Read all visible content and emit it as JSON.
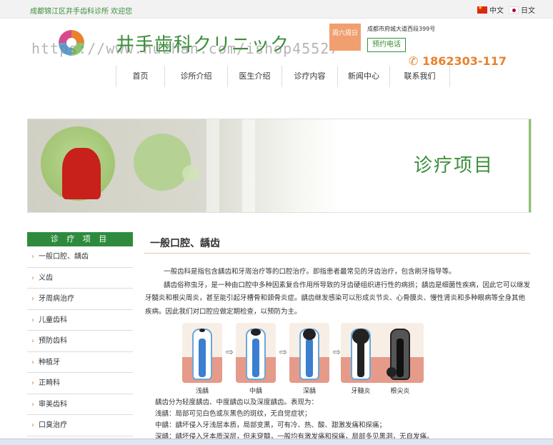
{
  "topbar": {
    "welcome": "成都锦江区井手齿科诊所 欢迎您",
    "lang_cn": "中文",
    "lang_jp": "日文"
  },
  "header": {
    "title": "井手歯科クリニック",
    "watermark": "https://www.huzhan.com/ishop45527",
    "hours": "周六周日",
    "address": "成都市府城大道西段399号",
    "reserve_label": "预约电话",
    "phone": "1862303-117"
  },
  "nav": {
    "items": [
      "首页",
      "诊所介绍",
      "医生介绍",
      "诊疗内容",
      "新闻中心",
      "联系我们"
    ]
  },
  "banner": {
    "title": "诊疗项目"
  },
  "sidebar": {
    "heading": "诊 疗 项 目",
    "items": [
      "一般口腔、龋齿",
      "义齿",
      "牙周病治疗",
      "儿童齿科",
      "预防齿科",
      "种植牙",
      "正畸科",
      "审美齿科",
      "口臭治疗"
    ]
  },
  "content": {
    "title": "一般口腔、龋齿",
    "paragraph1": "一般齿科是指包含龋齿和牙周治疗等的口腔治疗。即指患者最常见的牙齿治疗，包含刷牙指导等。",
    "paragraph2": "龋齿俗称虫牙，是一种由口腔中多种因素复合作用所导致的牙齿硬组织进行性的病损；龋齿是细菌性疾病，因此它可以继发牙髓炎和根尖周炎，甚至能引起牙槽骨和颌骨炎症。龋齿继发感染可以形成炎节炎、心骨膜炎、慢性肾炎和多种眼病等全身其他疾病。因此我们对口腔应做定期检查，以预防为主。",
    "tooth_labels": [
      "浅龋",
      "中龋",
      "深龋",
      "牙髓炎",
      "根尖炎"
    ],
    "lines": [
      "龋齿分为轻度龋齿、中度龋齿以及深度龋齿。表现为：",
      "浅龋：局部可见白色或灰黑色的斑纹，无自觉症状；",
      "中龋：龋坏侵入牙浅层本质，局部变黑，可有冷、热、酸、甜激发痛和探痛；",
      "深龋：龋坏侵入牙本质深层，但未穿髓，一般均有激发痛和探痛，局部多见黑洞，无自发痛。"
    ]
  },
  "colors": {
    "brand_green": "#3a8f3a",
    "sidebar_green": "#2e8b3e",
    "accent_orange": "#e8822e"
  }
}
